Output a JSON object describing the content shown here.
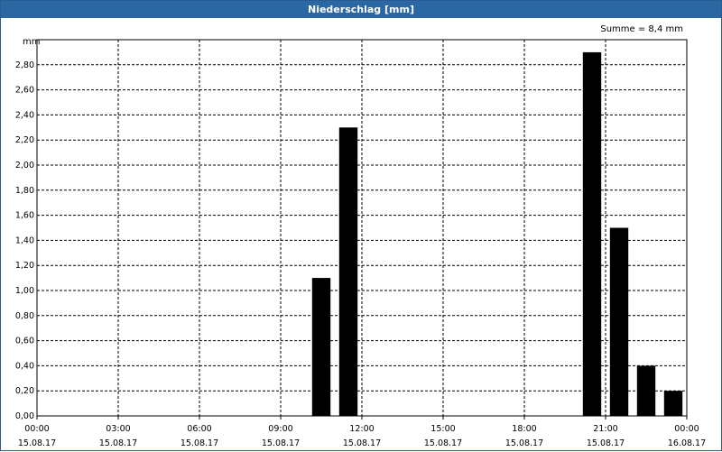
{
  "window": {
    "title": "Niederschlag [mm]"
  },
  "summary": {
    "text": "Summe = 8,4 mm"
  },
  "chart_data": {
    "type": "bar",
    "title": "Niederschlag [mm]",
    "ylabel": "mm",
    "ylim": [
      0,
      3.0
    ],
    "yticks": [
      "0,00",
      "0,20",
      "0,40",
      "0,60",
      "0,80",
      "1,00",
      "1,20",
      "1,40",
      "1,60",
      "1,80",
      "2,00",
      "2,20",
      "2,40",
      "2,60",
      "2,80"
    ],
    "xrange_hours": [
      0,
      24
    ],
    "xticks": [
      {
        "time": "00:00",
        "date": "15.08.17"
      },
      {
        "time": "03:00",
        "date": "15.08.17"
      },
      {
        "time": "06:00",
        "date": "15.08.17"
      },
      {
        "time": "09:00",
        "date": "15.08.17"
      },
      {
        "time": "12:00",
        "date": "15.08.17"
      },
      {
        "time": "15:00",
        "date": "15.08.17"
      },
      {
        "time": "18:00",
        "date": "15.08.17"
      },
      {
        "time": "21:00",
        "date": "15.08.17"
      },
      {
        "time": "00:00",
        "date": "16.08.17"
      }
    ],
    "bars": [
      {
        "hour": 11,
        "value": 1.1
      },
      {
        "hour": 12,
        "value": 2.3
      },
      {
        "hour": 21,
        "value": 2.9
      },
      {
        "hour": 22,
        "value": 1.5
      },
      {
        "hour": 23,
        "value": 0.4
      },
      {
        "hour": 24,
        "value": 0.2
      }
    ],
    "grid": true,
    "bar_color": "#000000"
  }
}
